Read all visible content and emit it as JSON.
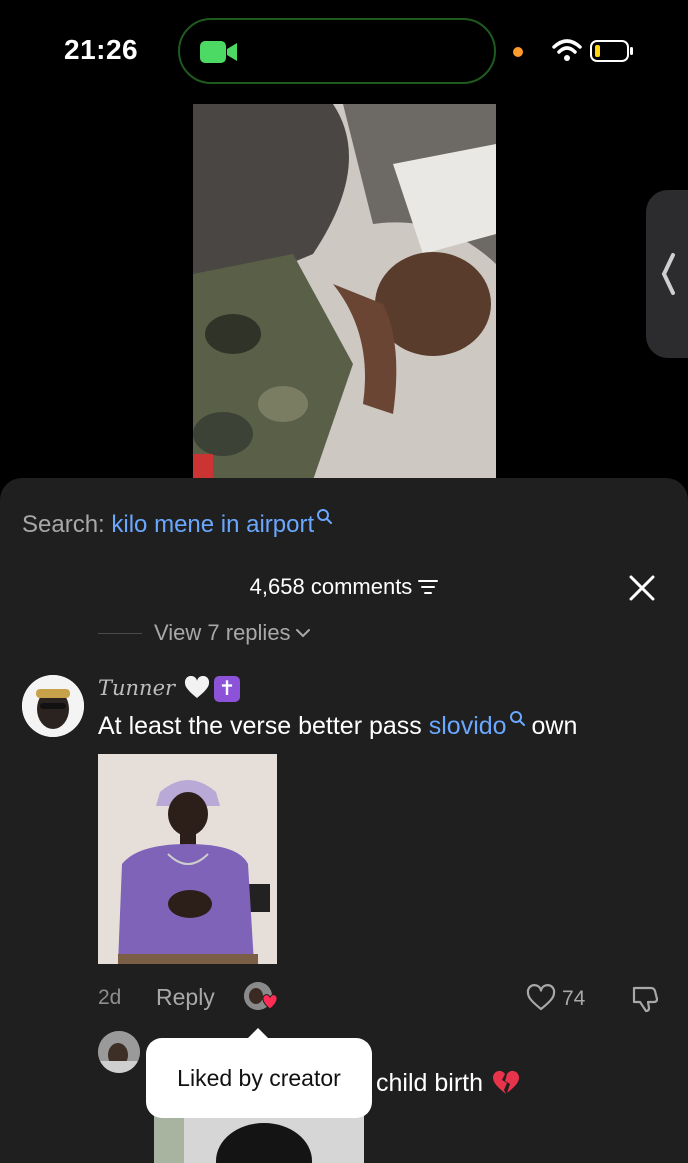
{
  "status_bar": {
    "time": "21:26"
  },
  "comments_panel": {
    "search_label": "Search: ",
    "search_query": "kilo mene in airport",
    "comment_count": "4,658 comments",
    "view_replies": "View 7 replies",
    "comments": [
      {
        "username": "Tunner",
        "badges": [
          "🤍",
          "✝"
        ],
        "text_before": "At least the verse better pass ",
        "mention": "slovido",
        "text_after": " own",
        "time": "2d",
        "reply_label": "Reply",
        "likes": "74"
      },
      {
        "text": "child birth",
        "emoji": "broken-heart-icon"
      }
    ],
    "tooltip": "Liked by creator"
  },
  "colors": {
    "panel_bg": "#1f1f1f",
    "link_blue": "#6aa7ff",
    "muted_text": "#a8a8a8",
    "facetime_green": "#4cd964",
    "badge_purple": "#8c52d8"
  }
}
